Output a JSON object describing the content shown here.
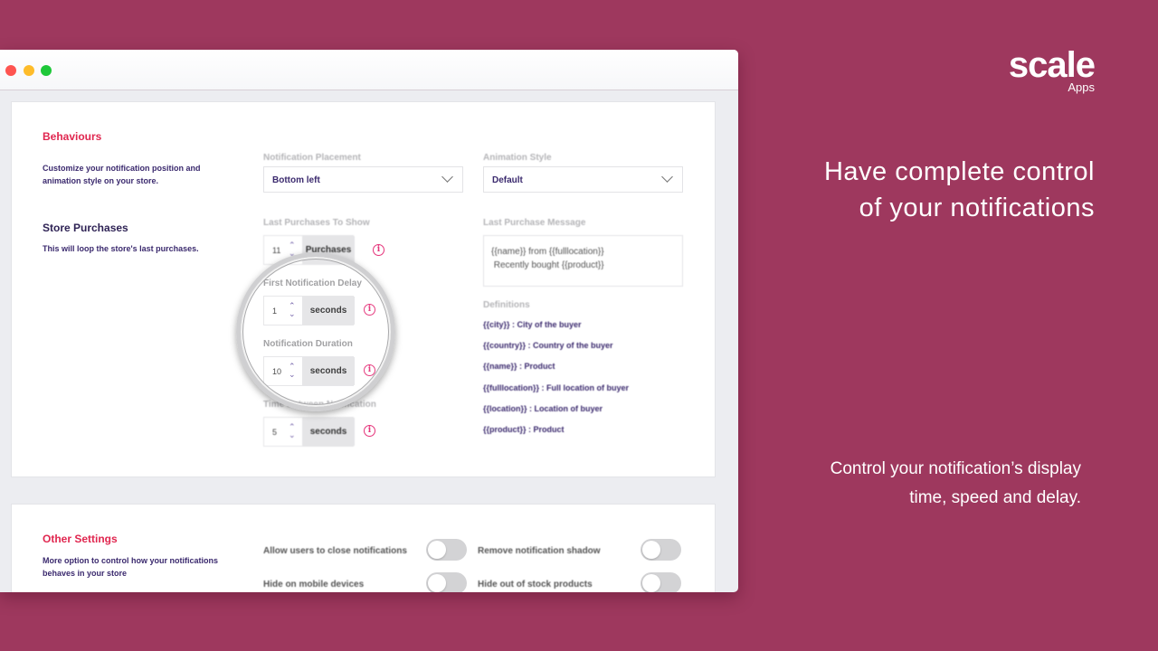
{
  "window": {
    "controls": [
      "close",
      "minimize",
      "maximize"
    ]
  },
  "behaviours": {
    "title": "Behaviours",
    "description": "Customize your notification position and animation style on your store.",
    "placement": {
      "label": "Notification Placement",
      "value": "Bottom left"
    },
    "animation": {
      "label": "Animation Style",
      "value": "Default"
    }
  },
  "store_purchases": {
    "title": "Store Purchases",
    "description": "This will loop the store's last purchases.",
    "last_purchases": {
      "label": "Last Purchases To Show",
      "value": "11",
      "unit": "Purchases"
    },
    "first_delay": {
      "label": "First Notification Delay",
      "value": "1",
      "unit": "seconds"
    },
    "duration": {
      "label": "Notification Duration",
      "value": "10",
      "unit": "seconds"
    },
    "time_between": {
      "label": "Time Between Notification",
      "value": "5",
      "unit": "seconds"
    },
    "message": {
      "label": "Last Purchase Message",
      "line1": "{{name}} from {{fulllocation}}",
      "line2": " Recently bought {{product}}"
    },
    "definitions": {
      "label": "Definitions",
      "items": [
        "{{city}} : City of the buyer",
        "{{country}} : Country of the buyer",
        "{{name}} : Product",
        "{{fulllocation}} : Full location of buyer",
        "{{location}} : Location of buyer",
        "{{product}} : Product"
      ]
    }
  },
  "other_settings": {
    "title": "Other Settings",
    "description": "More option to control how your notifications behaves in your store",
    "toggles": [
      {
        "label": "Allow users to close notifications",
        "on": false
      },
      {
        "label": "Remove notification shadow",
        "on": false
      },
      {
        "label": "Hide on mobile devices",
        "on": false
      },
      {
        "label": "Hide out of stock products",
        "on": false
      }
    ]
  },
  "icons": {
    "info": "i",
    "spin": "⌃⌄"
  },
  "brand": {
    "name": "scale",
    "sub": "Apps"
  },
  "marketing": {
    "headline": "Have complete control of your notifications",
    "subline": "Control your notification’s display time, speed and delay."
  },
  "colors": {
    "background": "#9e385e",
    "accent": "#e0264f",
    "text_primary": "#3b2a6e",
    "info_icon": "#e5337a"
  }
}
